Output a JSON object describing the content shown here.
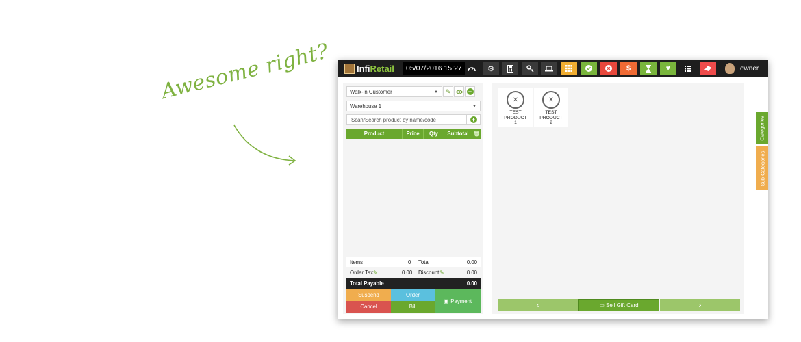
{
  "annotation": {
    "text": "Awesome right?"
  },
  "app": {
    "logo_part1": "Infi",
    "logo_part2": "Retail",
    "datetime": "05/07/2016 15:27",
    "user": "owner"
  },
  "toolbar": {
    "colors": {
      "yellow": "#f0ad31",
      "green": "#79b53c",
      "red": "#e8483c",
      "orange": "#ef6a34",
      "pink": "#ef4b4b"
    },
    "icons": [
      "dashboard-icon",
      "settings-icon",
      "calculator-icon",
      "key-icon",
      "laptop-icon",
      "grid-icon",
      "check-icon",
      "cancel-icon",
      "dollar-icon",
      "hourglass-icon",
      "heart-icon",
      "list-icon",
      "eraser-icon"
    ]
  },
  "pos": {
    "customer": "Walk-in Customer",
    "warehouse": "Warehouse 1",
    "search_placeholder": "Scan/Search product by name/code",
    "columns": {
      "product": "Product",
      "price": "Price",
      "qty": "Qty",
      "subtotal": "Subtotal"
    },
    "totals": {
      "items_label": "Items",
      "items_value": "0",
      "total_label": "Total",
      "total_value": "0.00",
      "order_tax_label": "Order Tax",
      "order_tax_value": "0.00",
      "discount_label": "Discount",
      "discount_value": "0.00",
      "payable_label": "Total Payable",
      "payable_value": "0.00"
    },
    "buttons": {
      "suspend": "Suspend",
      "order": "Order",
      "payment": "Payment",
      "cancel": "Cancel",
      "bill": "Bill"
    }
  },
  "products": [
    {
      "name_line1": "TEST PRODUCT",
      "name_line2": "1"
    },
    {
      "name_line1": "TEST PRODUCT",
      "name_line2": "2"
    }
  ],
  "pager": {
    "prev": "‹",
    "gift": "Sell Gift Card",
    "next": "›"
  },
  "sidebar_tabs": {
    "categories": "Categories",
    "sub_categories": "Sub Categories"
  }
}
